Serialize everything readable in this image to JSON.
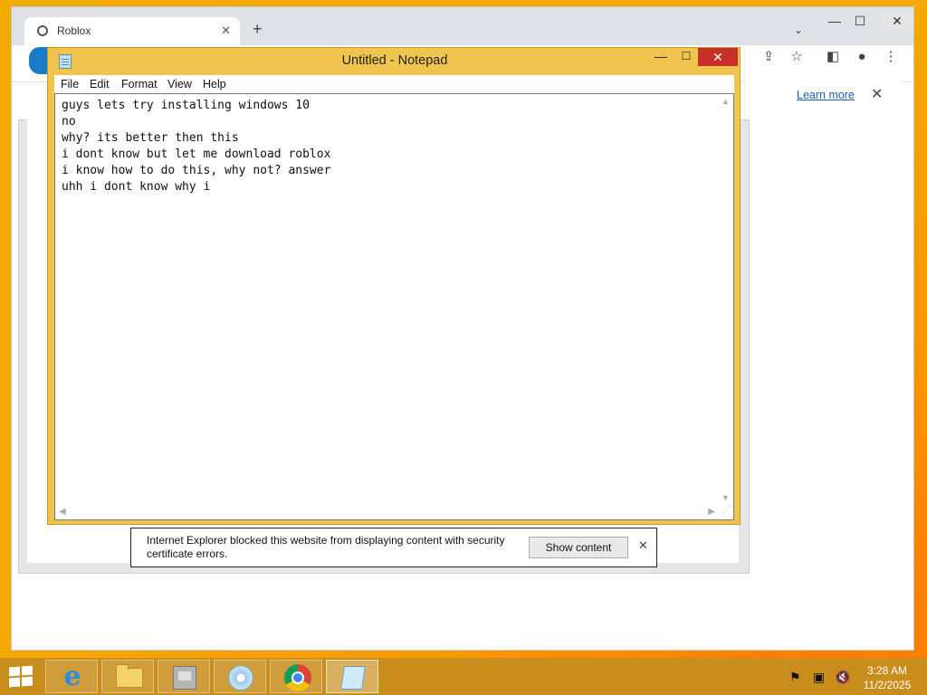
{
  "chrome": {
    "tab_title": "Roblox",
    "tab_close": "✕",
    "new_tab": "+",
    "tab_list": "⌄",
    "min": "—",
    "max": "☐",
    "close": "✕",
    "learn_more": "Learn more",
    "infobar_close": "✕"
  },
  "notepad": {
    "title": "Untitled - Notepad",
    "min": "—",
    "max": "☐",
    "close": "✕",
    "menu": [
      "File",
      "Edit",
      "Format",
      "View",
      "Help"
    ],
    "text": "guys lets try installing windows 10\nno\nwhy? its better then this\ni dont know but let me download roblox\ni know how to do this, why not? answer\nuhh i dont know why i"
  },
  "ie_notification": {
    "message": "Internet Explorer blocked this website from displaying content with security certificate errors.",
    "button": "Show content",
    "close": "✕"
  },
  "taskbar": {
    "apps": [
      {
        "name": "Internet Explorer",
        "icon": "ie-icon"
      },
      {
        "name": "File Explorer",
        "icon": "folder-icon"
      },
      {
        "name": "Program",
        "icon": "program-icon"
      },
      {
        "name": "Disc Utility",
        "icon": "disc-icon"
      },
      {
        "name": "Google Chrome",
        "icon": "chrome-icon"
      },
      {
        "name": "Notepad",
        "icon": "notepad-icon"
      }
    ],
    "time": "3:28 AM",
    "date": "11/2/2025"
  }
}
